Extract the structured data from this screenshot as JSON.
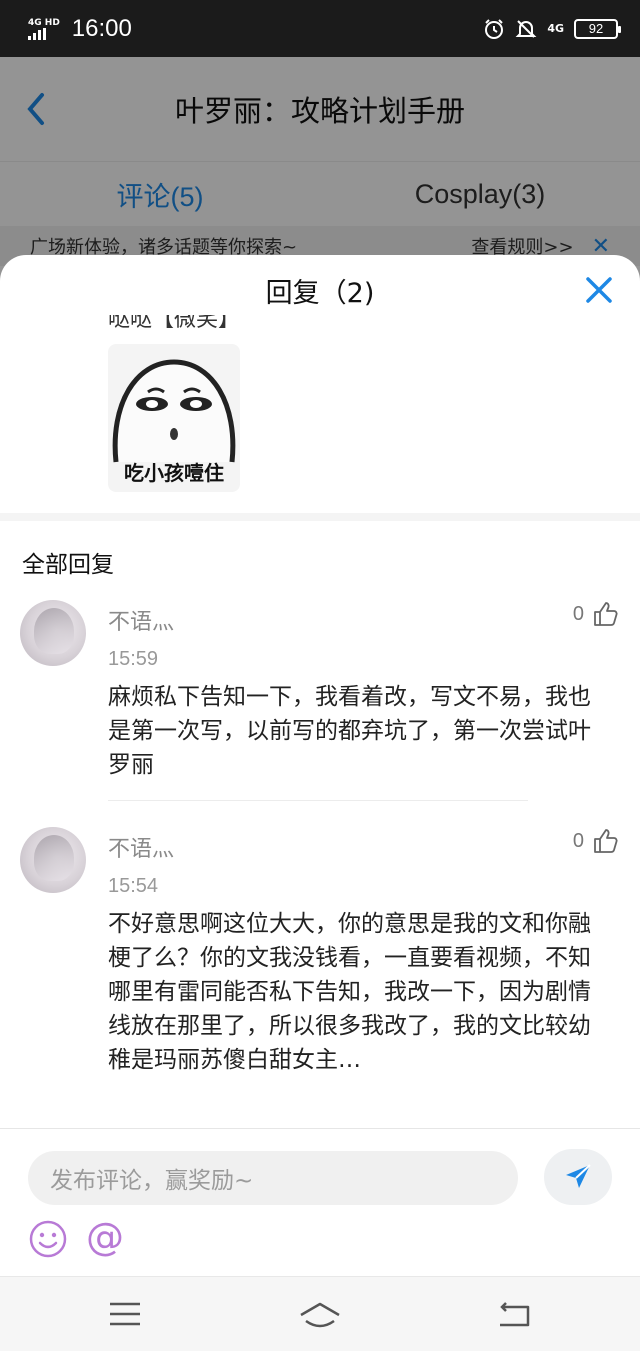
{
  "status_bar": {
    "network": "4G HD",
    "time": "16:00",
    "data_type": "4G",
    "battery": "92"
  },
  "background": {
    "title": "叶罗丽：攻略计划手册",
    "tabs": [
      {
        "label": "评论(5)"
      },
      {
        "label": "Cosplay(3)"
      }
    ],
    "notice": "广场新体验，诸多话题等你探索~",
    "notice_link": "查看规则>>"
  },
  "sheet": {
    "title": "回复（2)",
    "cut_text": "哒哒【微笑】",
    "sticker_caption": "吃小孩噎住",
    "section_title": "全部回复",
    "replies": [
      {
        "user": "不语灬",
        "likes": "0",
        "time": "15:59",
        "text": "麻烦私下告知一下，我看着改，写文不易，我也是第一次写，以前写的都弃坑了，第一次尝试叶罗丽"
      },
      {
        "user": "不语灬",
        "likes": "0",
        "time": "15:54",
        "text": "不好意思啊这位大大，你的意思是我的文和你融梗了么？你的文我没钱看，一直要看视频，不知哪里有雷同能否私下告知，我改一下，因为剧情线放在那里了，所以很多我改了，我的文比较幼稚是玛丽苏傻白甜女主…"
      }
    ],
    "input_placeholder": "发布评论，赢奖励~",
    "at_symbol": "@"
  },
  "colors": {
    "accent": "#1e88e5",
    "icon_purple": "#b87ad6"
  }
}
